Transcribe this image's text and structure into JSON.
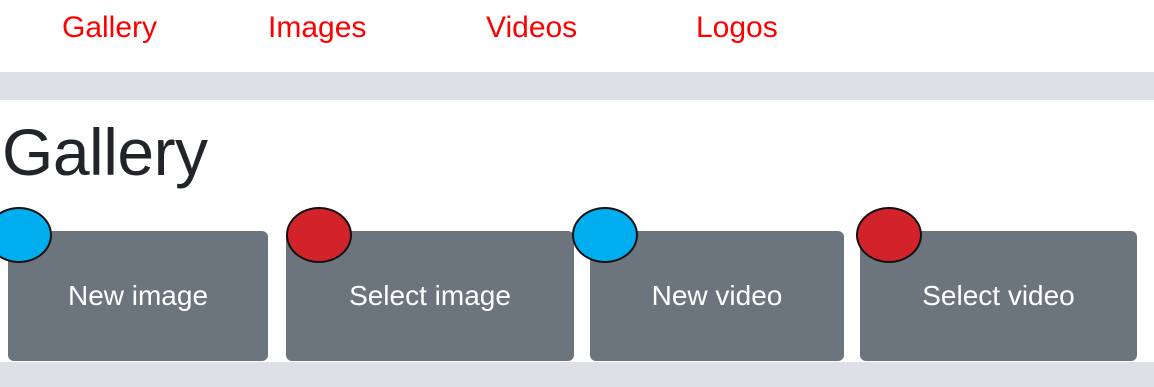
{
  "nav": {
    "items": [
      {
        "label": "Gallery"
      },
      {
        "label": "Images"
      },
      {
        "label": "Videos"
      },
      {
        "label": "Logos"
      }
    ]
  },
  "page": {
    "title": "Gallery"
  },
  "buttons": {
    "new_image": "New image",
    "select_image": "Select image",
    "new_video": "New video",
    "select_video": "Select video"
  },
  "colors": {
    "nav_link": "#ff0000",
    "band": "#dde1e7",
    "button_bg": "#6c757d",
    "button_text": "#ffffff",
    "title": "#212529",
    "marker_blue": "#00adef",
    "marker_red": "#d2232a"
  }
}
